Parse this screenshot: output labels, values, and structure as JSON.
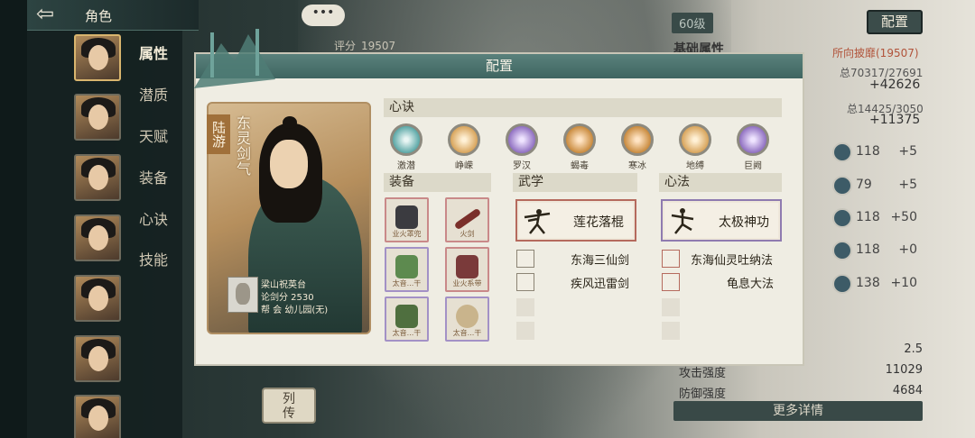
{
  "topbar": {
    "back": "⇦",
    "title": "角色"
  },
  "nav": [
    "属性",
    "潜质",
    "天赋",
    "装备",
    "心诀",
    "技能"
  ],
  "chat_btn": "•••",
  "score": {
    "label": "评分",
    "value": "19507"
  },
  "right": {
    "level": "60级",
    "config_btn": "配置",
    "basic_attr": "基础属性",
    "soulfate": "所向披靡(19507)",
    "sum1": "总70317/27691",
    "plus1": "+42626",
    "sum2": "总14425/3050",
    "plus2": "+11375",
    "stats": [
      {
        "value": "118",
        "delta": "+5"
      },
      {
        "value": "79",
        "delta": "+5"
      },
      {
        "value": "118",
        "delta": "+50"
      },
      {
        "value": "118",
        "delta": "+0"
      },
      {
        "value": "138",
        "delta": "+10"
      }
    ],
    "rows": [
      {
        "label": "",
        "value": "2.5"
      },
      {
        "label": "攻击强度",
        "value": "11029"
      },
      {
        "label": "防御强度",
        "value": "4684"
      }
    ],
    "more_btn": "更多详情"
  },
  "liezhuan": "列\n传",
  "dialog": {
    "title": "配置",
    "char_name": "陆游",
    "char_title": "东灵剑气",
    "info": {
      "sect": "梁山祝英台",
      "score": "论剑分 2530",
      "guild": "帮  会 幼儿园(无)"
    },
    "sections": {
      "xinjue": "心诀",
      "equip": "装备",
      "wuxue": "武学",
      "xinfa": "心法"
    },
    "skills": [
      {
        "label": "激潜",
        "color": "#5aa7a6"
      },
      {
        "label": "峥嵘",
        "color": "#d8a45b"
      },
      {
        "label": "罗汉",
        "color": "#8f6fc1"
      },
      {
        "label": "蝎毒",
        "color": "#c98a3d"
      },
      {
        "label": "寒冰",
        "color": "#c98a3d"
      },
      {
        "label": "地缚",
        "color": "#d8a45b"
      },
      {
        "label": "巨阙",
        "color": "#8f6fc1"
      }
    ],
    "equips": [
      {
        "label": "业火罩兜",
        "color": "#3b3b40"
      },
      {
        "label": "火剑",
        "color": "#7a2f2a"
      },
      {
        "label": "太音...干",
        "color": "#5d8a4f"
      },
      {
        "label": "业火系带",
        "color": "#7a3a3a"
      },
      {
        "label": "太音...干",
        "color": "#4f6f3f"
      },
      {
        "label": "太音...干",
        "color": "#c9b48c"
      }
    ],
    "wuxue_main": "莲花落棍",
    "xinfa_main": "太极神功",
    "wuxue_list": [
      "东海三仙剑",
      "疾风迅雷剑"
    ],
    "xinfa_list": [
      "东海仙灵吐纳法",
      "龟息大法"
    ]
  }
}
